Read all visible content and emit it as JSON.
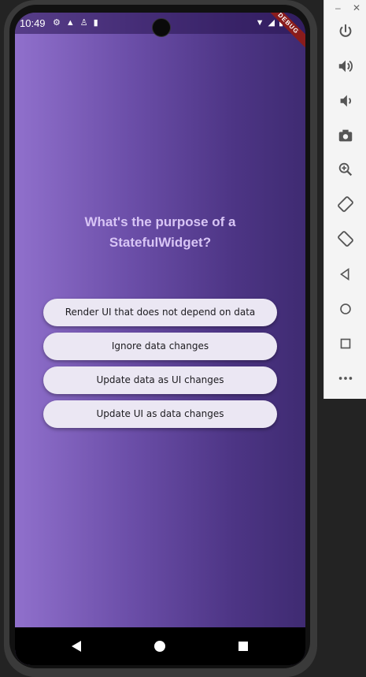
{
  "status_bar": {
    "time": "10:49",
    "debug_label": "DEBUG"
  },
  "quiz": {
    "question": "What's the purpose of a StatefulWidget?",
    "answers": [
      "Render UI that does not depend on data",
      "Ignore data changes",
      "Update data as UI changes",
      "Update UI as data changes"
    ]
  },
  "colors": {
    "gradient_start": "#9070cc",
    "gradient_end": "#3f2b72",
    "question_text": "#d8c5f5",
    "button_bg": "#ebe7f3"
  },
  "toolbar": {
    "icons": [
      "power-icon",
      "volume-up-icon",
      "volume-down-icon",
      "camera-icon",
      "zoom-icon",
      "rotate-left-icon",
      "rotate-right-icon",
      "back-icon",
      "home-icon",
      "overview-icon",
      "more-icon"
    ]
  }
}
